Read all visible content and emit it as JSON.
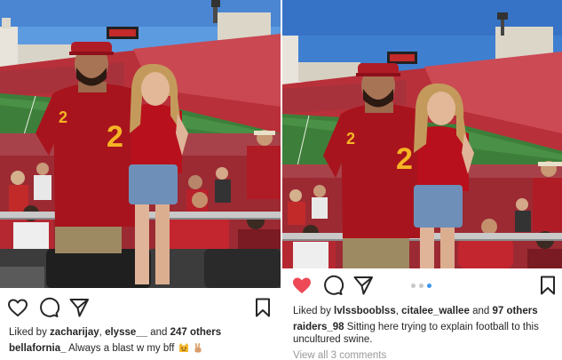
{
  "colors": {
    "sky": "#4f8ed6",
    "field": "#3d7f3a",
    "crowd": "#b8303a",
    "jersey": "#a8141d",
    "jersey_number": "#f5b524",
    "like_red": "#ed4956",
    "dot_active": "#3897f0",
    "muted_text": "#999999"
  },
  "posts": [
    {
      "icons": [
        "heart-outline-icon",
        "comment-icon",
        "share-icon",
        "bookmark-icon"
      ],
      "likes": {
        "prefix": "Liked by",
        "user1": "zacharijay",
        "sep": ",",
        "user2": "elysse__",
        "and": "and",
        "others": "247 others"
      },
      "caption": {
        "username": "bellafornia_",
        "text": "Always a blast w my bff",
        "emoji": [
          "smiling-cat-emoji",
          "victory-hand-emoji"
        ]
      }
    },
    {
      "icons": [
        "heart-filled-icon",
        "comment-icon",
        "share-icon",
        "bookmark-icon"
      ],
      "liked": true,
      "carousel": {
        "count": 3,
        "active": 2
      },
      "likes": {
        "prefix": "Liked by",
        "user1": "lvlssbooblss",
        "sep": ",",
        "user2": "citalee_wallee",
        "and": "and",
        "others": "97 others"
      },
      "caption": {
        "username": "raiders_98",
        "text": "Sitting here trying to explain football to this uncultured swine."
      },
      "view_all": "View all 3 comments"
    }
  ]
}
